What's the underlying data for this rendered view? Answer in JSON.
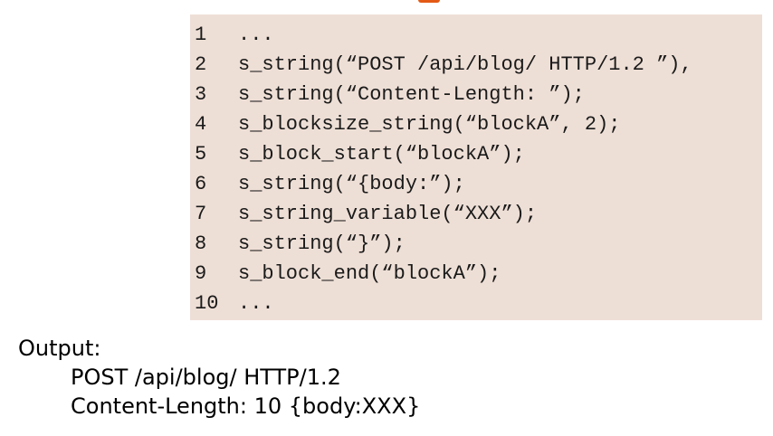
{
  "code": {
    "lines": [
      {
        "num": "1",
        "text": "..."
      },
      {
        "num": "2",
        "text": "s_string(“POST /api/blog/ HTTP/1.2 ”),"
      },
      {
        "num": "3",
        "text": "s_string(“Content-Length: ”);"
      },
      {
        "num": "4",
        "text": "s_blocksize_string(“blockA”, 2);"
      },
      {
        "num": "5",
        "text": "s_block_start(“blockA”);"
      },
      {
        "num": "6",
        "text": "s_string(“{body:”);"
      },
      {
        "num": "7",
        "text": "s_string_variable(“XXX”);"
      },
      {
        "num": "8",
        "text": "s_string(“}”);"
      },
      {
        "num": "9",
        "text": "s_block_end(“blockA”);"
      },
      {
        "num": "10",
        "text": "..."
      }
    ]
  },
  "output": {
    "label": "Output:",
    "lines": [
      "POST /api/blog/ HTTP/1.2",
      "Content-Length: 10 {body:XXX}"
    ]
  },
  "colors": {
    "code_background": "#eedfd6",
    "accent": "#e35a16"
  }
}
